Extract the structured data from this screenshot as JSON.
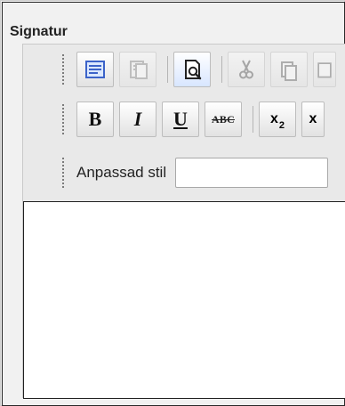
{
  "title": "Signatur",
  "toolbar": {
    "row1": [
      {
        "name": "source-icon",
        "disabled": false
      },
      {
        "name": "templates-icon",
        "disabled": true
      },
      {
        "name": "preview-icon",
        "disabled": false,
        "active": true
      },
      {
        "name": "cut-icon",
        "disabled": true
      },
      {
        "name": "copy-icon",
        "disabled": true
      },
      {
        "name": "paste-icon",
        "disabled": true
      }
    ],
    "row2": [
      {
        "label": "B"
      },
      {
        "label": "I"
      },
      {
        "label": "U"
      },
      {
        "label": "ABC"
      },
      {
        "label": "x",
        "subscript": "2"
      },
      {
        "label": "x"
      }
    ],
    "style_label": "Anpassad stil",
    "style_value": ""
  }
}
